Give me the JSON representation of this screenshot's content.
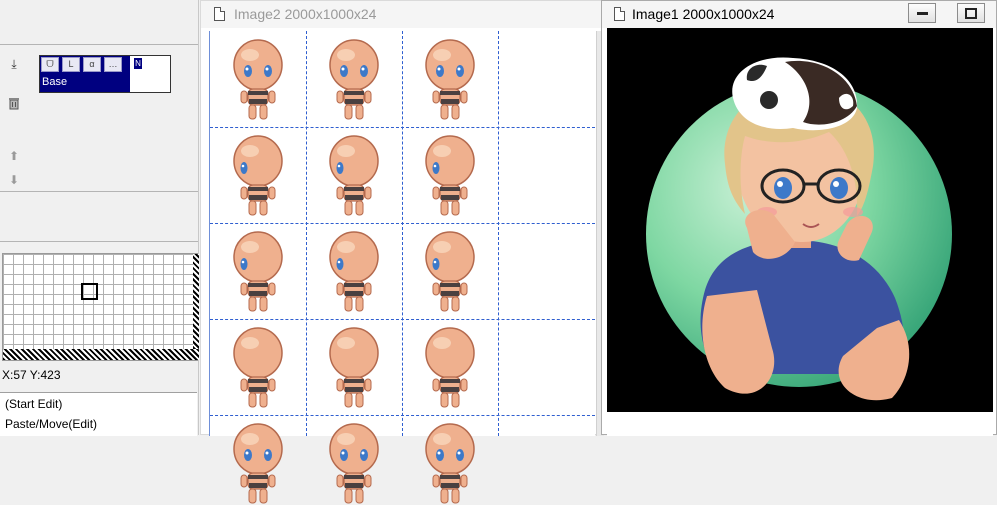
{
  "layers": {
    "tools": [
      "ᗜ",
      "L",
      "α",
      "…"
    ],
    "base_name": "Base",
    "thumb_label": "N"
  },
  "status": {
    "coords": "X:57 Y:423"
  },
  "history": [
    "(Start Edit)",
    "Paste/Move(Edit)"
  ],
  "windows": {
    "image2": {
      "title": "Image2 2000x1000x24"
    },
    "image1": {
      "title": "Image1 2000x1000x24"
    }
  },
  "colors": {
    "layer_selected": "#000080",
    "grid_line": "#2f5fd0",
    "skin": "#efb08e",
    "circle_green": "#7ed7a2",
    "shirt_blue": "#3b52a0",
    "hair_blonde": "#e2c48a"
  },
  "icons": [
    "import-icon",
    "trash-icon",
    "arrow-up-icon",
    "arrow-down-icon",
    "minimize-icon",
    "maximize-icon"
  ]
}
